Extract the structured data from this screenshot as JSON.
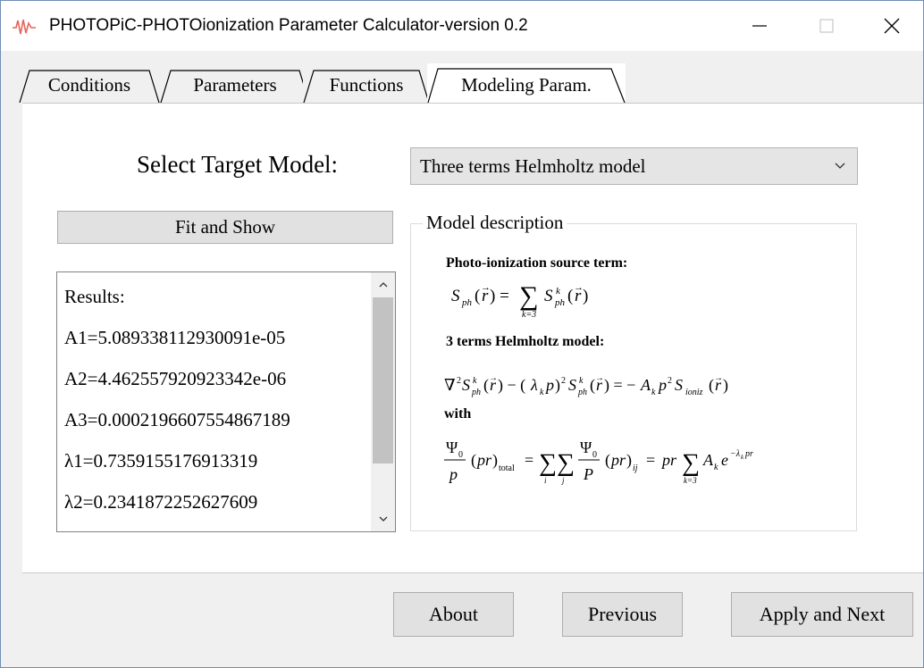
{
  "window": {
    "title": "PHOTOPiC-PHOTOionization Parameter Calculator-version 0.2"
  },
  "tabs": [
    {
      "label": "Conditions"
    },
    {
      "label": "Parameters"
    },
    {
      "label": "Functions"
    },
    {
      "label": "Modeling Param."
    }
  ],
  "target": {
    "label": "Select Target Model:",
    "selected": "Three terms Helmholtz model"
  },
  "fit_button": "Fit and Show",
  "results": {
    "lines": [
      "Results:",
      "A1=5.089338112930091e-05",
      "A2=4.462557920923342e-06",
      "A3=0.0002196607554867189",
      "λ1=0.7359155176913319",
      "λ2=0.2341872252627609"
    ]
  },
  "description": {
    "title": "Model description",
    "heading1": "Photo-ionization source term:",
    "heading2": "3 terms Helmholtz model:",
    "with": "with"
  },
  "buttons": {
    "about": "About",
    "previous": "Previous",
    "apply_next": "Apply and Next"
  }
}
